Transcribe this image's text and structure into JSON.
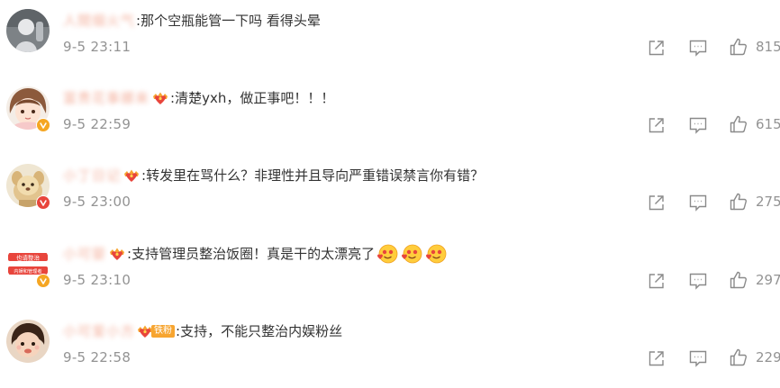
{
  "comments": [
    {
      "username": "人間烟火气",
      "badge": "none",
      "text": ":那个空瓶能管一下吗 看得头晕",
      "timestamp": "9-5 23:11",
      "likes": "815",
      "verified": false,
      "avatar_icon": "grey-figure-avatar"
    },
    {
      "username": "富贵花事娜来",
      "badge": "fan-crown",
      "text": ":清楚yxh，做正事吧！！！",
      "timestamp": "9-5 22:59",
      "likes": "615",
      "verified": true,
      "avatar_icon": "anime-girl-avatar"
    },
    {
      "username": "小丁日记",
      "badge": "fan-crown",
      "text": ":转发里在骂什么？非理性并且导向严重错误禁言你有错？",
      "timestamp": "9-5 23:00",
      "likes": "275",
      "verified": true,
      "avatar_icon": "cartoon-animal-avatar"
    },
    {
      "username": "小可婴",
      "badge": "fan-crown",
      "text": ":支持管理员整治饭圈！真是干的太漂亮了",
      "timestamp": "9-5 23:10",
      "likes": "297",
      "verified": true,
      "avatar_icon": "red-text-sticker-avatar",
      "avatar_text_top": "也请整治",
      "avatar_text_bottom": "内娱和管理者",
      "emoji_count": 3
    },
    {
      "username": "小可爱小方",
      "badge": "iron-fan",
      "badge_label": "铁粉",
      "text": ":支持，不能只整治内娱粉丝",
      "timestamp": "9-5 22:58",
      "likes": "229",
      "verified": false,
      "avatar_icon": "child-photo-avatar"
    }
  ],
  "icons": {
    "share": "share-icon",
    "comment": "comment-icon",
    "like": "like-icon",
    "fan_badge": "fan-crown-icon",
    "verified": "verified-v-icon",
    "emoji": "heart-eyes-emoji-icon"
  },
  "colors": {
    "text": "#333333",
    "meta": "#939393",
    "username": "#eb7350",
    "badge_orange": "#f7a530",
    "verified_orange": "#f5a623"
  }
}
